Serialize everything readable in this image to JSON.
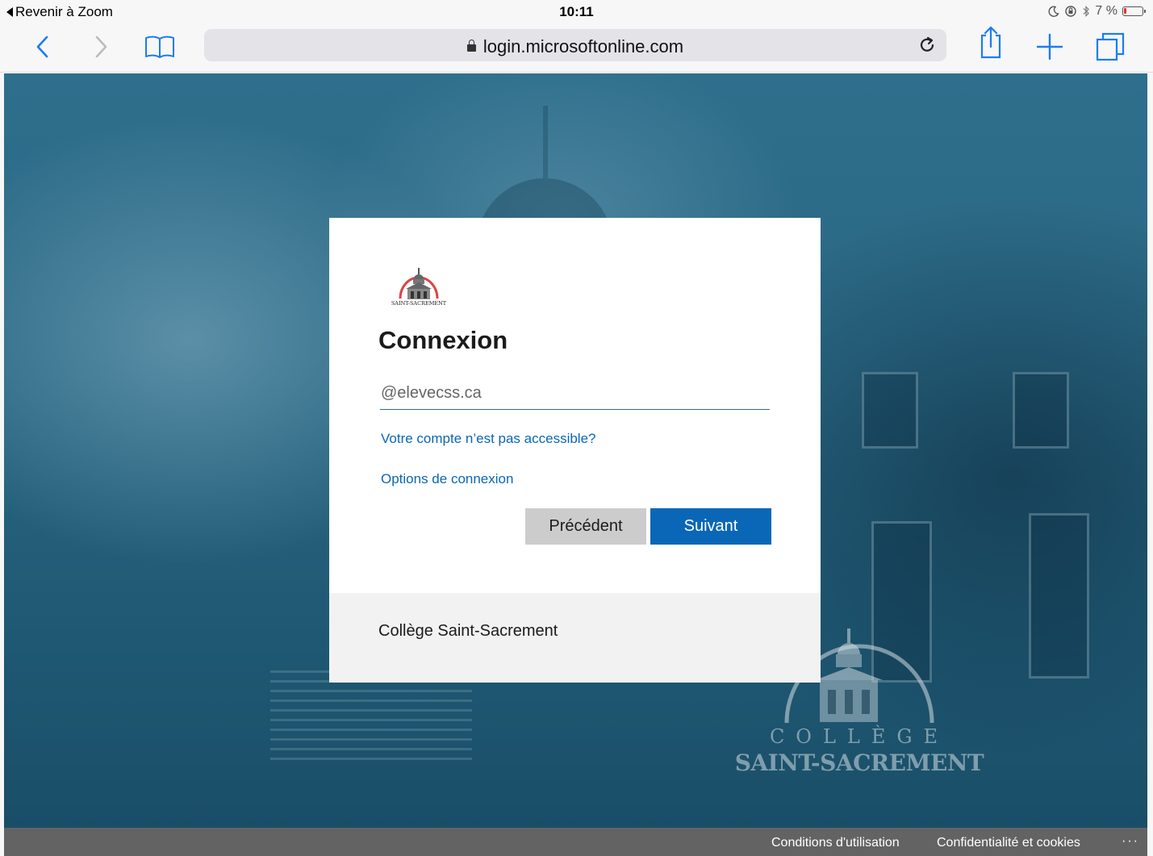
{
  "status_bar": {
    "back_label": "Revenir à Zoom",
    "time": "10:11",
    "battery_text": "7 %",
    "icons": [
      "moon-icon",
      "orientation-lock-icon",
      "bluetooth-icon",
      "battery-icon"
    ]
  },
  "toolbar": {
    "url": "login.microsoftonline.com",
    "icons": [
      "back-chevron-icon",
      "forward-chevron-icon",
      "bookmarks-icon",
      "lock-icon",
      "reload-icon",
      "share-icon",
      "new-tab-icon",
      "tabs-icon"
    ]
  },
  "card": {
    "logo_text": "SAINT-SACREMENT",
    "title": "Connexion",
    "email_placeholder": "@elevecss.ca",
    "link_account": "Votre compte n’est pas accessible?",
    "link_options": "Options de connexion",
    "button_back": "Précédent",
    "button_next": "Suivant",
    "footer_text": "Collège Saint-Sacrement"
  },
  "background_logo": {
    "line1": "COLLÈGE",
    "line2": "SAINT-SACREMENT"
  },
  "page_footer": {
    "terms": "Conditions d'utilisation",
    "privacy": "Confidentialité et cookies",
    "more": "···"
  },
  "colors": {
    "accent": "#0a67b8",
    "link": "#0a66b8",
    "background": "#2a6783"
  }
}
